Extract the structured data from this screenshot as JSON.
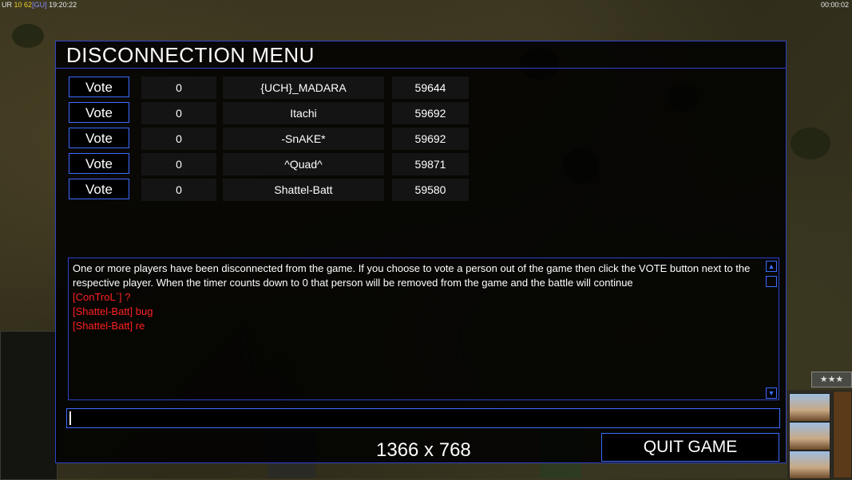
{
  "hud": {
    "top_left": {
      "prefix": "UR",
      "value1": "10",
      "value2": "62",
      "bracket": "[GU]",
      "time": "19:20:22"
    },
    "top_right": "00:00:02",
    "rank_stars": "★★★"
  },
  "dialog": {
    "title": "DISCONNECTION MENU",
    "vote_label": "Vote",
    "players": [
      {
        "votes": "0",
        "name": "{UCH}_MADARA",
        "ping": "59644"
      },
      {
        "votes": "0",
        "name": "Itachi",
        "ping": "59692"
      },
      {
        "votes": "0",
        "name": "-SnAKE*",
        "ping": "59692"
      },
      {
        "votes": "0",
        "name": "^Quad^",
        "ping": "59871"
      },
      {
        "votes": "0",
        "name": "Shattel-Batt",
        "ping": "59580"
      }
    ],
    "messages": {
      "system": "One or more players have been disconnected from the game. If you choose to vote a person out of the game then click the VOTE button next to the respective player. When the timer counts down to 0 that person will be removed from the game and the battle will continue",
      "chat": [
        "[ConTroL`] ?",
        "[Shattel-Batt] bug",
        "[Shattel-Batt] re"
      ]
    },
    "chat_input_value": "",
    "resolution": "1366 x 768",
    "quit_label": "QUIT GAME"
  },
  "colors": {
    "accent": "#3b6cff",
    "chat_text": "#ff2020",
    "title": "#ffffff"
  }
}
